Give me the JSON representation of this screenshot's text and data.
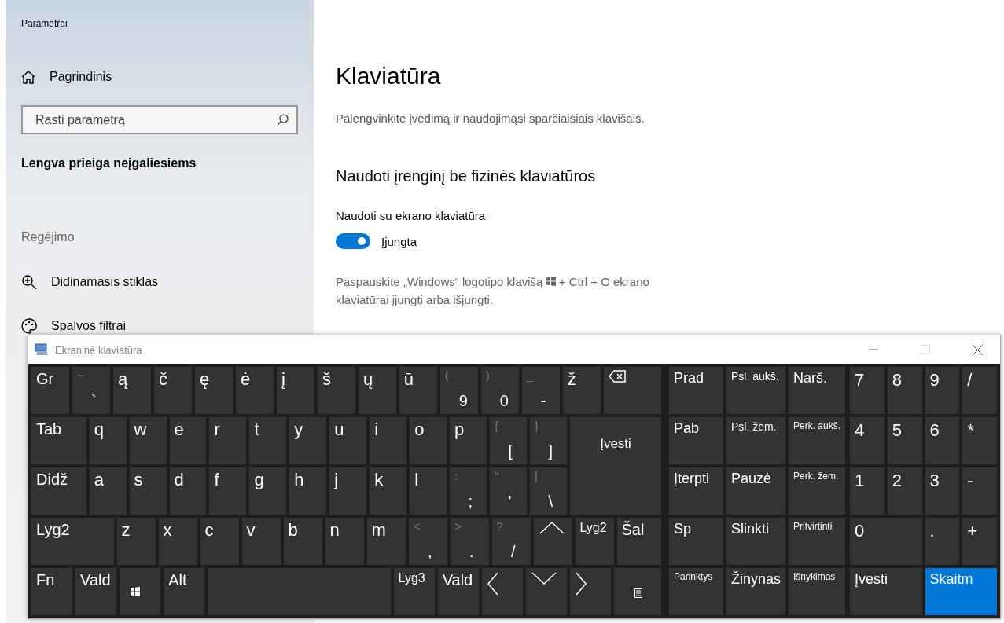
{
  "settings": {
    "window_title": "Parametrai",
    "home": "Pagrindinis",
    "search": {
      "placeholder": "Rasti parametrą"
    },
    "section": "Lengva prieiga neįgaliesiems",
    "group": "Regėjimo",
    "items": [
      {
        "label": "Didinamasis stiklas",
        "kind": "magnifier"
      },
      {
        "label": "Spalvos filtrai",
        "kind": "palette"
      }
    ],
    "page": {
      "title": "Klaviatūra",
      "subtitle": "Palengvinkite įvedimą ir naudojimąsi sparčiaisiais klavišais.",
      "heading": "Naudoti įrenginį be fizinės klaviatūros",
      "setting_label": "Naudoti su ekrano klaviatūra",
      "toggle": {
        "on": true,
        "label": "Įjungta"
      },
      "hint_before": "Paspauskite „Windows“ logotipo klavišą",
      "hint_after": "+ Ctrl + O ekrano",
      "hint_continued": "klaviatūrai įjungti arba išjungti."
    }
  },
  "keyboard": {
    "title": "Ekraninė klaviatūra",
    "rows": [
      {
        "keys": [
          {
            "kind": "label",
            "label": "Gr"
          },
          {
            "kind": "dual",
            "shift": "~",
            "label": "`"
          },
          {
            "kind": "char",
            "label": "ą"
          },
          {
            "kind": "char",
            "label": "č"
          },
          {
            "kind": "char",
            "label": "ę"
          },
          {
            "kind": "char",
            "label": "ė"
          },
          {
            "kind": "char",
            "label": "į"
          },
          {
            "kind": "char",
            "label": "š"
          },
          {
            "kind": "char",
            "label": "ų"
          },
          {
            "kind": "char",
            "label": "ū"
          },
          {
            "kind": "dual",
            "shift": "(",
            "label": "9"
          },
          {
            "kind": "dual",
            "shift": ")",
            "label": "0"
          },
          {
            "kind": "dual",
            "shift": "_",
            "label": "-"
          },
          {
            "kind": "char",
            "label": "ž"
          },
          {
            "kind": "backspace"
          }
        ]
      },
      {
        "keys": [
          {
            "kind": "label",
            "label": "Tab"
          },
          {
            "kind": "char",
            "label": "q"
          },
          {
            "kind": "char",
            "label": "w"
          },
          {
            "kind": "char",
            "label": "e"
          },
          {
            "kind": "char",
            "label": "r"
          },
          {
            "kind": "char",
            "label": "t"
          },
          {
            "kind": "char",
            "label": "y"
          },
          {
            "kind": "char",
            "label": "u"
          },
          {
            "kind": "char",
            "label": "i"
          },
          {
            "kind": "char",
            "label": "o"
          },
          {
            "kind": "char",
            "label": "p"
          },
          {
            "kind": "dual",
            "shift": "{",
            "label": "["
          },
          {
            "kind": "dual",
            "shift": "}",
            "label": "]"
          }
        ]
      },
      {
        "keys": [
          {
            "kind": "label",
            "label": "Didž"
          },
          {
            "kind": "char",
            "label": "a"
          },
          {
            "kind": "char",
            "label": "s"
          },
          {
            "kind": "char",
            "label": "d"
          },
          {
            "kind": "char",
            "label": "f"
          },
          {
            "kind": "char",
            "label": "g"
          },
          {
            "kind": "char",
            "label": "h"
          },
          {
            "kind": "char",
            "label": "j"
          },
          {
            "kind": "char",
            "label": "k"
          },
          {
            "kind": "char",
            "label": "l"
          },
          {
            "kind": "dual",
            "shift": ":",
            "label": ";"
          },
          {
            "kind": "dual",
            "shift": "\"",
            "label": "'"
          },
          {
            "kind": "dual",
            "shift": "|",
            "label": "\\"
          }
        ]
      },
      {
        "keys": [
          {
            "kind": "label",
            "label": "Lyg2"
          },
          {
            "kind": "char",
            "label": "z"
          },
          {
            "kind": "char",
            "label": "x"
          },
          {
            "kind": "char",
            "label": "c"
          },
          {
            "kind": "char",
            "label": "v"
          },
          {
            "kind": "char",
            "label": "b"
          },
          {
            "kind": "char",
            "label": "n"
          },
          {
            "kind": "char",
            "label": "m"
          },
          {
            "kind": "dual",
            "shift": "<",
            "label": ","
          },
          {
            "kind": "dual",
            "shift": ">",
            "label": "."
          },
          {
            "kind": "dual",
            "shift": "?",
            "label": "/"
          },
          {
            "kind": "up"
          },
          {
            "kind": "small",
            "label": "Lyg2"
          },
          {
            "kind": "label",
            "label": "Šal"
          }
        ]
      },
      {
        "keys": [
          {
            "kind": "label",
            "label": "Fn"
          },
          {
            "kind": "label",
            "label": "Vald"
          },
          {
            "kind": "windows"
          },
          {
            "kind": "label",
            "label": "Alt"
          },
          {
            "kind": "space"
          },
          {
            "kind": "small",
            "label": "Lyg3"
          },
          {
            "kind": "label",
            "label": "Vald"
          },
          {
            "kind": "left"
          },
          {
            "kind": "down"
          },
          {
            "kind": "right"
          },
          {
            "kind": "menu"
          }
        ]
      }
    ],
    "enter": "Įvesti",
    "nav": [
      "Prad",
      "Psl. aukš.",
      "Narš.",
      "Pab",
      "Psl. žem.",
      "Perk. aukš.",
      "Įterpti",
      "Pauzė",
      "Perk. žem.",
      "Sp",
      "Slinkti",
      "Pritvirtinti",
      "Parinktys",
      "Žinynas",
      "Išnykimas"
    ],
    "numpad": [
      {
        "label": "7",
        "selected": false
      },
      {
        "label": "8",
        "selected": false
      },
      {
        "label": "9",
        "selected": false
      },
      {
        "label": "/",
        "selected": false
      },
      {
        "label": "4",
        "selected": false
      },
      {
        "label": "5",
        "selected": false
      },
      {
        "label": "6",
        "selected": false
      },
      {
        "label": "*",
        "selected": false
      },
      {
        "label": "1",
        "selected": false
      },
      {
        "label": "2",
        "selected": false
      },
      {
        "label": "3",
        "selected": false
      },
      {
        "label": "-",
        "selected": false
      },
      {
        "label": "0",
        "selected": false
      },
      {
        "label": ".",
        "selected": false
      },
      {
        "label": "+",
        "selected": false
      },
      {
        "label": "Įvesti",
        "selected": false
      },
      {
        "label": "Skaitm",
        "selected": true
      }
    ]
  }
}
